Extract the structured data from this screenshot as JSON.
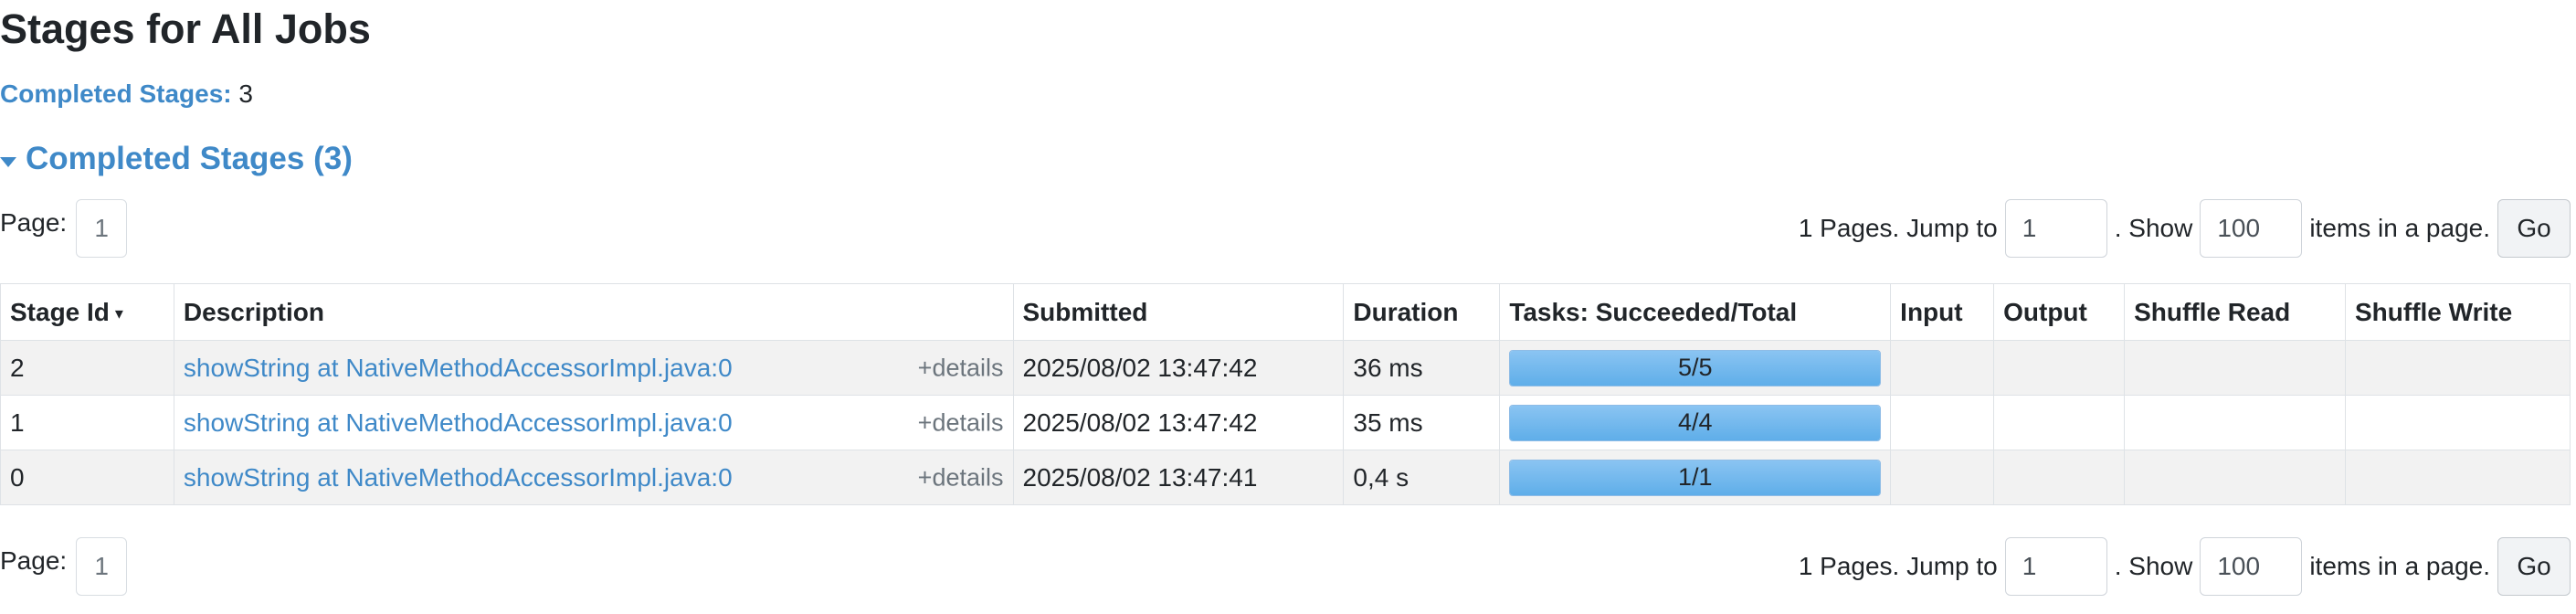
{
  "page": {
    "title": "Stages for All Jobs"
  },
  "summary": {
    "label": "Completed Stages:",
    "count": "3"
  },
  "section": {
    "title": "Completed Stages (3)"
  },
  "pagination": {
    "page_label": "Page:",
    "current_page": "1",
    "pages_text": "1 Pages. Jump to",
    "jump_value": "1",
    "show_text": ". Show",
    "show_value": "100",
    "items_text": "items in a page.",
    "go_label": "Go"
  },
  "table": {
    "columns": [
      "Stage Id",
      "Description",
      "Submitted",
      "Duration",
      "Tasks: Succeeded/Total",
      "Input",
      "Output",
      "Shuffle Read",
      "Shuffle Write"
    ],
    "sort_indicator": "▾",
    "details_label": "+details",
    "rows": [
      {
        "stage_id": "2",
        "description": "showString at NativeMethodAccessorImpl.java:0",
        "submitted": "2025/08/02 13:47:42",
        "duration": "36 ms",
        "tasks": "5/5",
        "progress": 1.0,
        "input": "",
        "output": "",
        "shuffle_read": "",
        "shuffle_write": ""
      },
      {
        "stage_id": "1",
        "description": "showString at NativeMethodAccessorImpl.java:0",
        "submitted": "2025/08/02 13:47:42",
        "duration": "35 ms",
        "tasks": "4/4",
        "progress": 1.0,
        "input": "",
        "output": "",
        "shuffle_read": "",
        "shuffle_write": ""
      },
      {
        "stage_id": "0",
        "description": "showString at NativeMethodAccessorImpl.java:0",
        "submitted": "2025/08/02 13:47:41",
        "duration": "0,4 s",
        "tasks": "1/1",
        "progress": 1.0,
        "input": "",
        "output": "",
        "shuffle_read": "",
        "shuffle_write": ""
      }
    ]
  },
  "colors": {
    "link": "#3f89c8",
    "progress_fill": "#5faee9",
    "row_stripe": "#f2f2f2"
  }
}
